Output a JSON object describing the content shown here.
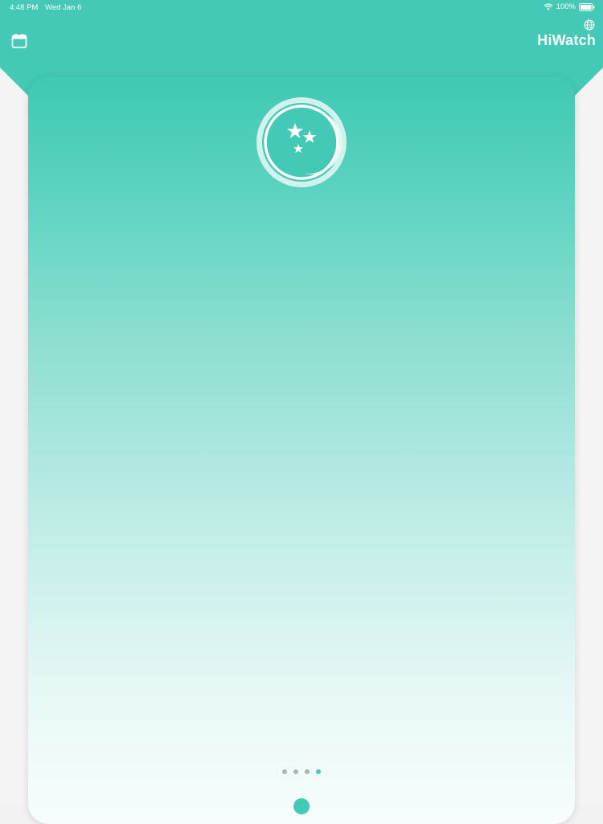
{
  "status_bar": {
    "time": "4:48 PM",
    "date": "Wed Jan 6",
    "battery_percent": "100%",
    "icons": [
      "wifi-icon",
      "battery-icon"
    ]
  },
  "header": {
    "title": "HiWatch",
    "left_icon": "calendar-icon",
    "right_icon": "globe-icon"
  },
  "card": {
    "badge_icon": "moon-stars-icon",
    "pagination": {
      "total": 4,
      "active_index": 3
    }
  },
  "colors": {
    "accent": "#43c9b5",
    "background": "#f2f2f2",
    "dot_inactive": "#a9b5b3"
  }
}
